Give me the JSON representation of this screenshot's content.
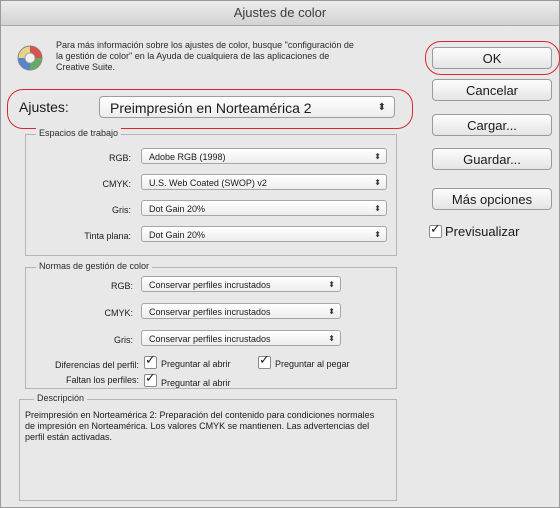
{
  "window": {
    "title": "Ajustes de color"
  },
  "info": {
    "icon": "color-wheel-icon",
    "text": "Para más información sobre los ajustes de color, busque \"configuración de la gestión de color\" en la Ayuda de cualquiera de las aplicaciones de Creative Suite."
  },
  "settings": {
    "label": "Ajustes:",
    "value": "Preimpresión en Norteamérica 2"
  },
  "workspaces": {
    "title": "Espacios de trabajo",
    "rgb_label": "RGB:",
    "rgb_value": "Adobe RGB (1998)",
    "cmyk_label": "CMYK:",
    "cmyk_value": "U.S. Web Coated (SWOP) v2",
    "gray_label": "Gris:",
    "gray_value": "Dot Gain 20%",
    "spot_label": "Tinta plana:",
    "spot_value": "Dot Gain 20%"
  },
  "policies": {
    "title": "Normas de gestión de color",
    "rgb_label": "RGB:",
    "rgb_value": "Conservar perfiles incrustados",
    "cmyk_label": "CMYK:",
    "cmyk_value": "Conservar perfiles incrustados",
    "gray_label": "Gris:",
    "gray_value": "Conservar perfiles incrustados",
    "mismatch_label": "Diferencias del perfil:",
    "ask_open_label": "Preguntar al abrir",
    "ask_paste_label": "Preguntar al pegar",
    "missing_label": "Faltan los perfiles:",
    "ask_open_missing_label": "Preguntar al abrir"
  },
  "description": {
    "title": "Descripción",
    "text": "Preimpresión en Norteamérica 2:  Preparación del contenido para condiciones normales de impresión en Norteamérica. Los valores CMYK se mantienen. Las advertencias del perfil están activadas."
  },
  "buttons": {
    "ok": "OK",
    "cancel": "Cancelar",
    "load": "Cargar...",
    "save": "Guardar...",
    "more": "Más opciones"
  },
  "preview": {
    "label": "Previsualizar",
    "checked": true
  },
  "arrow_glyph": "⌃⌄"
}
